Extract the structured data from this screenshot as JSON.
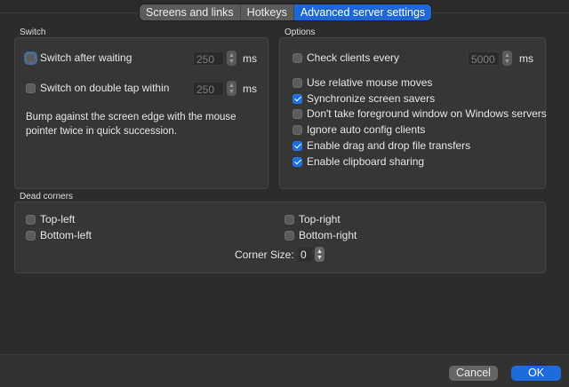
{
  "tabs": [
    {
      "label": "Screens and links",
      "active": false
    },
    {
      "label": "Hotkeys",
      "active": false
    },
    {
      "label": "Advanced server settings",
      "active": true
    }
  ],
  "switch_group": {
    "title": "Switch",
    "after_waiting": {
      "label": "Switch after waiting",
      "checked": false,
      "value": "250",
      "unit": "ms"
    },
    "double_tap": {
      "label": "Switch on double tap within",
      "checked": false,
      "value": "250",
      "unit": "ms"
    },
    "note": "Bump against the screen edge with the mouse pointer twice in quick succession."
  },
  "options_group": {
    "title": "Options",
    "check_clients": {
      "label": "Check clients every",
      "checked": false,
      "value": "5000",
      "unit": "ms"
    },
    "items": [
      {
        "label": "Use relative mouse moves",
        "checked": false
      },
      {
        "label": "Synchronize screen savers",
        "checked": true
      },
      {
        "label": "Don't take foreground window on Windows servers",
        "checked": false
      },
      {
        "label": "Ignore auto config clients",
        "checked": false
      },
      {
        "label": "Enable drag and drop file transfers",
        "checked": true
      },
      {
        "label": "Enable clipboard sharing",
        "checked": true
      }
    ]
  },
  "dead_corners": {
    "title": "Dead corners",
    "top_left": {
      "label": "Top-left",
      "checked": false
    },
    "top_right": {
      "label": "Top-right",
      "checked": false
    },
    "bottom_left": {
      "label": "Bottom-left",
      "checked": false
    },
    "bottom_right": {
      "label": "Bottom-right",
      "checked": false
    },
    "corner_size_label": "Corner Size:",
    "corner_size_value": "0"
  },
  "buttons": {
    "cancel": "Cancel",
    "ok": "OK"
  },
  "colors": {
    "accent": "#1e6bdb",
    "background": "#323232",
    "panel": "#363636"
  }
}
